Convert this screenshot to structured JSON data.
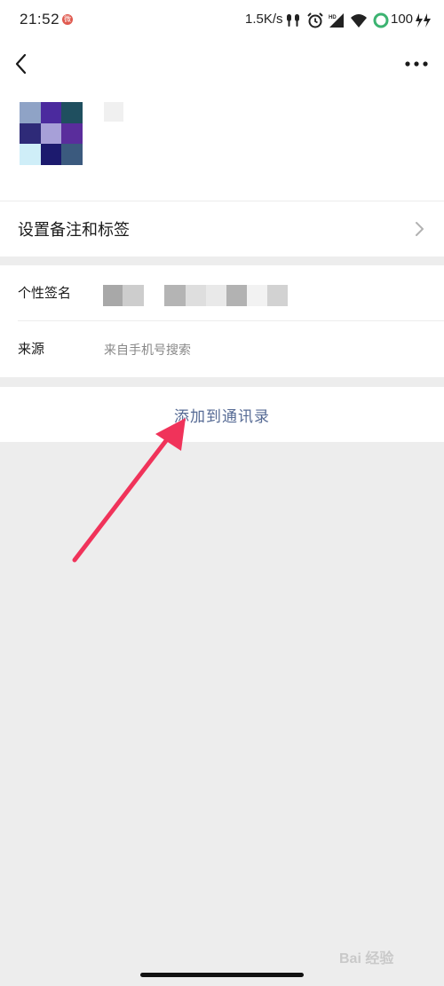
{
  "status_bar": {
    "time": "21:52",
    "notification_badge": "微",
    "network_speed": "1.5K/s",
    "battery": "100",
    "icons": [
      "earbuds-icon",
      "alarm-icon",
      "hd-signal-icon",
      "wifi-icon",
      "battery-ring-icon",
      "charging-icon"
    ]
  },
  "nav": {
    "back_icon": "chevron-left-icon",
    "more_icon": "more-dots-icon"
  },
  "profile": {
    "avatar_colors": [
      "#8fa3c6",
      "#4b2a9e",
      "#1f4f5f",
      "#2e2a78",
      "#a7a0d8",
      "#5a2d9c",
      "#cfeef8",
      "#1c1a6e",
      "#3b5a7e"
    ]
  },
  "remark_row": {
    "label": "设置备注和标签"
  },
  "info": {
    "signature_label": "个性签名",
    "source_label": "来源",
    "source_value": "来自手机号搜索"
  },
  "action": {
    "add_label": "添加到通讯录"
  },
  "annotation": {
    "arrow_color": "#f0335a"
  },
  "watermark": {
    "text": "Bai 经验"
  },
  "colors": {
    "link_blue": "#576b95",
    "background": "#ededed"
  }
}
